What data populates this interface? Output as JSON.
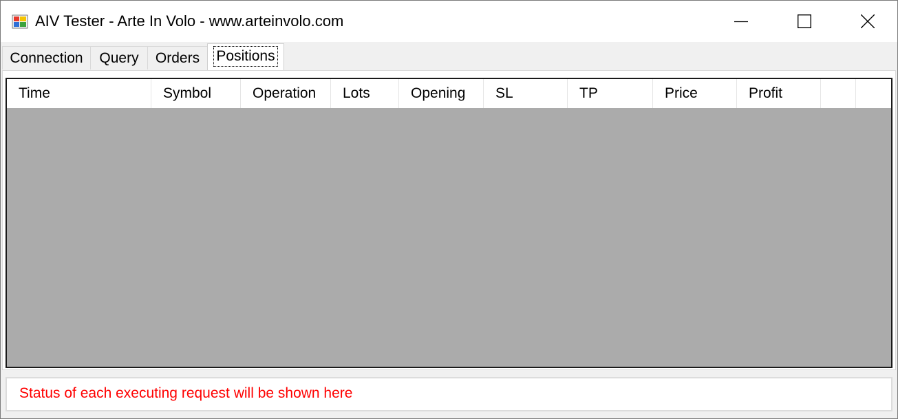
{
  "window": {
    "title": "AIV Tester - Arte In Volo - www.arteinvolo.com"
  },
  "controls": {
    "minimize": "minimize-icon",
    "maximize": "maximize-icon",
    "close": "close-icon"
  },
  "tabs": [
    {
      "label": "Connection",
      "active": false
    },
    {
      "label": "Query",
      "active": false
    },
    {
      "label": "Orders",
      "active": false
    },
    {
      "label": "Positions",
      "active": true
    }
  ],
  "positions": {
    "columns": [
      "Time",
      "Symbol",
      "Operation",
      "Lots",
      "Opening",
      "SL",
      "TP",
      "Price",
      "Profit",
      "",
      ""
    ],
    "rows": []
  },
  "status": {
    "text": "Status of each executing request will be shown here",
    "color": "#ff0000"
  },
  "colors": {
    "listview_background": "#ababab",
    "window_background": "#f0f0f0"
  }
}
